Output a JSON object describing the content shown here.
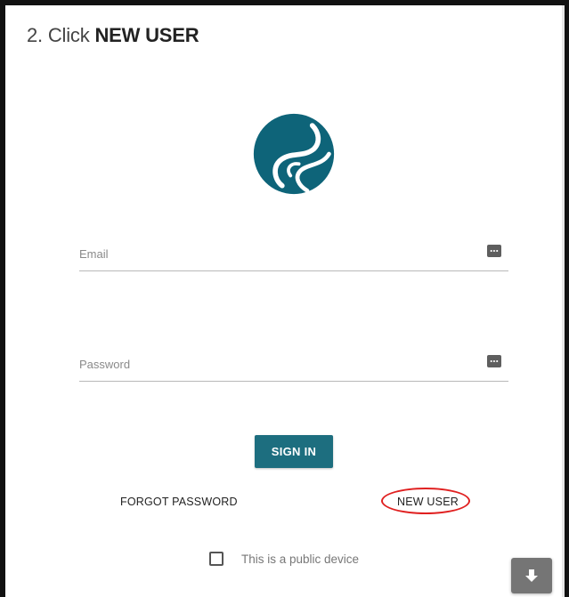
{
  "instruction": {
    "prefix": "2. Click ",
    "emphasis": "NEW USER"
  },
  "logo": {
    "icon": "brand-swirl-logo",
    "color": "#0e6479"
  },
  "form": {
    "email_placeholder": "Email",
    "password_placeholder": "Password",
    "field_icon": "password-manager-icon",
    "signin_label": "SIGN IN",
    "accent_color": "#1d6e7f"
  },
  "links": {
    "forgot_password": "FORGOT PASSWORD",
    "new_user": "NEW USER",
    "highlight_color": "#e02020"
  },
  "public_device": {
    "label": "This is a public device",
    "checked": false
  },
  "floating_action": {
    "icon": "download-arrow-icon"
  }
}
